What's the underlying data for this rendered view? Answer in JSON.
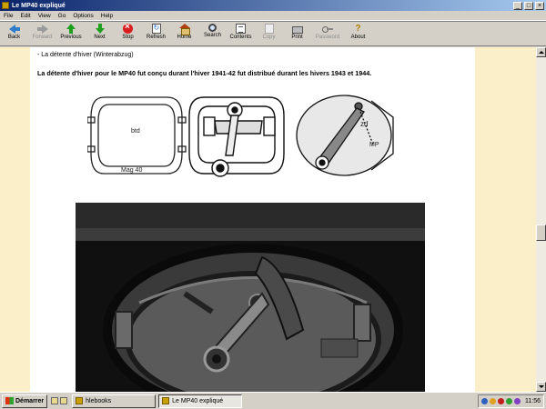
{
  "window": {
    "title": "Le MP40 expliqué",
    "controls": [
      "_",
      "□",
      "×"
    ]
  },
  "menu": [
    "File",
    "Edit",
    "View",
    "Go",
    "Options",
    "Help"
  ],
  "toolbar": [
    {
      "label": "Back",
      "icon": "back-arrow-icon",
      "enabled": true
    },
    {
      "label": "Forward",
      "icon": "forward-arrow-icon",
      "enabled": false
    },
    {
      "label": "Previous",
      "icon": "previous-arrow-icon",
      "enabled": true
    },
    {
      "label": "Next",
      "icon": "next-arrow-icon",
      "enabled": true
    },
    {
      "label": "Stop",
      "icon": "stop-icon",
      "enabled": true
    },
    {
      "label": "Refresh",
      "icon": "refresh-icon",
      "enabled": true
    },
    {
      "label": "Home",
      "icon": "home-icon",
      "enabled": true
    },
    {
      "label": "Search",
      "icon": "search-icon",
      "enabled": true
    },
    {
      "label": "Contents",
      "icon": "contents-icon",
      "enabled": true
    },
    {
      "label": "Copy",
      "icon": "copy-icon",
      "enabled": false
    },
    {
      "label": "Print",
      "icon": "print-icon",
      "enabled": true
    },
    {
      "label": "Password",
      "icon": "password-icon",
      "enabled": false
    },
    {
      "label": "About",
      "icon": "about-icon",
      "enabled": true
    }
  ],
  "page": {
    "section_title": "- La détente d'hiver (Winterabzug)",
    "section_text": "La détente d'hiver pour le MP40 fut conçu durant l'hiver 1941-42 fut distribué durant les hivers 1943 et 1944.",
    "drawing_labels": {
      "cover_mark": "btd",
      "cover_date": "Mag 40",
      "plate_mark1": "zd",
      "plate_mark2": "MP"
    }
  },
  "taskbar": {
    "start_label": "Démarrer",
    "tasks": [
      {
        "label": "hlebooks",
        "active": false
      },
      {
        "label": "Le MP40 expliqué",
        "active": true
      }
    ],
    "clock": "11:56"
  }
}
